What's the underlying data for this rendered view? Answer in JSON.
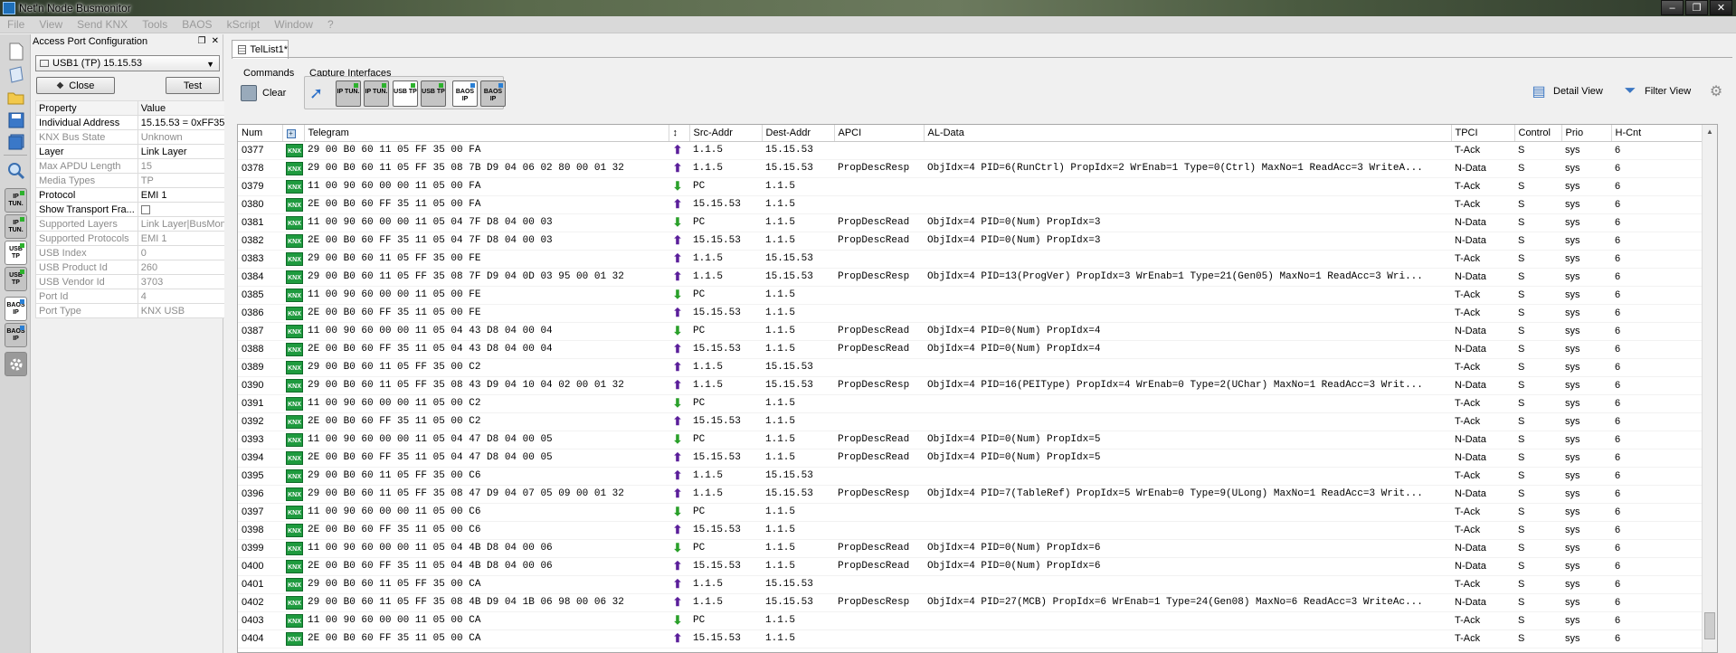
{
  "window": {
    "title": "Net'n Node Busmonitor",
    "minimize": "–",
    "maximize": "❐",
    "close": "✕"
  },
  "menu": [
    "File",
    "View",
    "Send KNX",
    "Tools",
    "BAOS",
    "kScript",
    "Window",
    "?"
  ],
  "left_toolbar": {
    "ip_tun_1": "IP TUN.",
    "ip_tun_2": "IP TUN.",
    "usb_tp_1": "USB TP",
    "usb_tp_2": "USB TP",
    "baos_ip_1": "BAOS IP",
    "baos_ip_2": "BAOS IP"
  },
  "access_port": {
    "header": "Access Port Configuration",
    "selected_port": "USB1 (TP) 15.15.53",
    "close_label": "Close",
    "test_label": "Test",
    "columns": [
      "Property",
      "Value"
    ],
    "properties": [
      {
        "name": "Individual Address",
        "value": "15.15.53 = 0xFF35",
        "enabled": true
      },
      {
        "name": "KNX Bus State",
        "value": "Unknown",
        "enabled": false
      },
      {
        "name": "Layer",
        "value": "Link Layer",
        "enabled": true
      },
      {
        "name": "Max APDU Length",
        "value": "15",
        "enabled": false
      },
      {
        "name": "Media Types",
        "value": "TP",
        "enabled": false
      },
      {
        "name": "Protocol",
        "value": "EMI 1",
        "enabled": true
      },
      {
        "name": "Show Transport Fra...",
        "value": "",
        "enabled": true,
        "checkbox": true
      },
      {
        "name": "Supported Layers",
        "value": "Link Layer|BusMon",
        "enabled": false
      },
      {
        "name": "Supported Protocols",
        "value": "EMI 1",
        "enabled": false
      },
      {
        "name": "USB Index",
        "value": "0",
        "enabled": false
      },
      {
        "name": "USB Product Id",
        "value": "260",
        "enabled": false
      },
      {
        "name": "USB Vendor Id",
        "value": "3703",
        "enabled": false
      },
      {
        "name": "Port Id",
        "value": "4",
        "enabled": false
      },
      {
        "name": "Port Type",
        "value": "KNX USB",
        "enabled": false
      }
    ]
  },
  "tab": {
    "label": "TelList1*"
  },
  "toolbar": {
    "commands_label": "Commands",
    "clear_label": "Clear",
    "capture_label": "Capture Interfaces",
    "cap_ip_tun_1": "IP TUN.",
    "cap_ip_tun_2": "IP TUN.",
    "cap_usb_tp_1": "USB TP",
    "cap_usb_tp_2": "USB TP",
    "cap_baos_ip_1": "BAOS IP",
    "cap_baos_ip_2": "BAOS IP",
    "detail_view": "Detail View",
    "filter_view": "Filter View"
  },
  "grid": {
    "columns": [
      "Num",
      "",
      "Telegram",
      "↕",
      "Src-Addr",
      "Dest-Addr",
      "APCI",
      "AL-Data",
      "TPCI",
      "Control",
      "Prio",
      "H-Cnt"
    ],
    "knx_badge": "KNX",
    "rows": [
      {
        "num": "0377",
        "tel": "29 00 B0 60 11 05 FF 35 00 FA",
        "dir": "up",
        "src": "1.1.5",
        "dst": "15.15.53",
        "apci": "",
        "al": "",
        "tpci": "T-Ack",
        "ctl": "S",
        "prio": "sys",
        "hc": "6"
      },
      {
        "num": "0378",
        "tel": "29 00 B0 60 11 05 FF 35 08 7B D9 04 06 02 80 00 01 32",
        "dir": "up",
        "src": "1.1.5",
        "dst": "15.15.53",
        "apci": "PropDescResp",
        "al": "ObjIdx=4 PID=6(RunCtrl) PropIdx=2 WrEnab=1 Type=0(Ctrl) MaxNo=1 ReadAcc=3 WriteA...",
        "tpci": "N-Data",
        "ctl": "S",
        "prio": "sys",
        "hc": "6"
      },
      {
        "num": "0379",
        "tel": "11 00 90 60 00 00 11 05 00 FA",
        "dir": "down",
        "src": "PC",
        "dst": "1.1.5",
        "apci": "",
        "al": "",
        "tpci": "T-Ack",
        "ctl": "S",
        "prio": "sys",
        "hc": "6"
      },
      {
        "num": "0380",
        "tel": "2E 00 B0 60 FF 35 11 05 00 FA",
        "dir": "up",
        "src": "15.15.53",
        "dst": "1.1.5",
        "apci": "",
        "al": "",
        "tpci": "T-Ack",
        "ctl": "S",
        "prio": "sys",
        "hc": "6"
      },
      {
        "num": "0381",
        "tel": "11 00 90 60 00 00 11 05 04 7F D8 04 00 03",
        "dir": "down",
        "src": "PC",
        "dst": "1.1.5",
        "apci": "PropDescRead",
        "al": "ObjIdx=4 PID=0(Num) PropIdx=3",
        "tpci": "N-Data",
        "ctl": "S",
        "prio": "sys",
        "hc": "6"
      },
      {
        "num": "0382",
        "tel": "2E 00 B0 60 FF 35 11 05 04 7F D8 04 00 03",
        "dir": "up",
        "src": "15.15.53",
        "dst": "1.1.5",
        "apci": "PropDescRead",
        "al": "ObjIdx=4 PID=0(Num) PropIdx=3",
        "tpci": "N-Data",
        "ctl": "S",
        "prio": "sys",
        "hc": "6"
      },
      {
        "num": "0383",
        "tel": "29 00 B0 60 11 05 FF 35 00 FE",
        "dir": "up",
        "src": "1.1.5",
        "dst": "15.15.53",
        "apci": "",
        "al": "",
        "tpci": "T-Ack",
        "ctl": "S",
        "prio": "sys",
        "hc": "6"
      },
      {
        "num": "0384",
        "tel": "29 00 B0 60 11 05 FF 35 08 7F D9 04 0D 03 95 00 01 32",
        "dir": "up",
        "src": "1.1.5",
        "dst": "15.15.53",
        "apci": "PropDescResp",
        "al": "ObjIdx=4 PID=13(ProgVer) PropIdx=3 WrEnab=1 Type=21(Gen05) MaxNo=1 ReadAcc=3 Wri...",
        "tpci": "N-Data",
        "ctl": "S",
        "prio": "sys",
        "hc": "6"
      },
      {
        "num": "0385",
        "tel": "11 00 90 60 00 00 11 05 00 FE",
        "dir": "down",
        "src": "PC",
        "dst": "1.1.5",
        "apci": "",
        "al": "",
        "tpci": "T-Ack",
        "ctl": "S",
        "prio": "sys",
        "hc": "6"
      },
      {
        "num": "0386",
        "tel": "2E 00 B0 60 FF 35 11 05 00 FE",
        "dir": "up",
        "src": "15.15.53",
        "dst": "1.1.5",
        "apci": "",
        "al": "",
        "tpci": "T-Ack",
        "ctl": "S",
        "prio": "sys",
        "hc": "6"
      },
      {
        "num": "0387",
        "tel": "11 00 90 60 00 00 11 05 04 43 D8 04 00 04",
        "dir": "down",
        "src": "PC",
        "dst": "1.1.5",
        "apci": "PropDescRead",
        "al": "ObjIdx=4 PID=0(Num) PropIdx=4",
        "tpci": "N-Data",
        "ctl": "S",
        "prio": "sys",
        "hc": "6"
      },
      {
        "num": "0388",
        "tel": "2E 00 B0 60 FF 35 11 05 04 43 D8 04 00 04",
        "dir": "up",
        "src": "15.15.53",
        "dst": "1.1.5",
        "apci": "PropDescRead",
        "al": "ObjIdx=4 PID=0(Num) PropIdx=4",
        "tpci": "N-Data",
        "ctl": "S",
        "prio": "sys",
        "hc": "6"
      },
      {
        "num": "0389",
        "tel": "29 00 B0 60 11 05 FF 35 00 C2",
        "dir": "up",
        "src": "1.1.5",
        "dst": "15.15.53",
        "apci": "",
        "al": "",
        "tpci": "T-Ack",
        "ctl": "S",
        "prio": "sys",
        "hc": "6"
      },
      {
        "num": "0390",
        "tel": "29 00 B0 60 11 05 FF 35 08 43 D9 04 10 04 02 00 01 32",
        "dir": "up",
        "src": "1.1.5",
        "dst": "15.15.53",
        "apci": "PropDescResp",
        "al": "ObjIdx=4 PID=16(PEIType) PropIdx=4 WrEnab=0 Type=2(UChar) MaxNo=1 ReadAcc=3 Writ...",
        "tpci": "N-Data",
        "ctl": "S",
        "prio": "sys",
        "hc": "6"
      },
      {
        "num": "0391",
        "tel": "11 00 90 60 00 00 11 05 00 C2",
        "dir": "down",
        "src": "PC",
        "dst": "1.1.5",
        "apci": "",
        "al": "",
        "tpci": "T-Ack",
        "ctl": "S",
        "prio": "sys",
        "hc": "6"
      },
      {
        "num": "0392",
        "tel": "2E 00 B0 60 FF 35 11 05 00 C2",
        "dir": "up",
        "src": "15.15.53",
        "dst": "1.1.5",
        "apci": "",
        "al": "",
        "tpci": "T-Ack",
        "ctl": "S",
        "prio": "sys",
        "hc": "6"
      },
      {
        "num": "0393",
        "tel": "11 00 90 60 00 00 11 05 04 47 D8 04 00 05",
        "dir": "down",
        "src": "PC",
        "dst": "1.1.5",
        "apci": "PropDescRead",
        "al": "ObjIdx=4 PID=0(Num) PropIdx=5",
        "tpci": "N-Data",
        "ctl": "S",
        "prio": "sys",
        "hc": "6"
      },
      {
        "num": "0394",
        "tel": "2E 00 B0 60 FF 35 11 05 04 47 D8 04 00 05",
        "dir": "up",
        "src": "15.15.53",
        "dst": "1.1.5",
        "apci": "PropDescRead",
        "al": "ObjIdx=4 PID=0(Num) PropIdx=5",
        "tpci": "N-Data",
        "ctl": "S",
        "prio": "sys",
        "hc": "6"
      },
      {
        "num": "0395",
        "tel": "29 00 B0 60 11 05 FF 35 00 C6",
        "dir": "up",
        "src": "1.1.5",
        "dst": "15.15.53",
        "apci": "",
        "al": "",
        "tpci": "T-Ack",
        "ctl": "S",
        "prio": "sys",
        "hc": "6"
      },
      {
        "num": "0396",
        "tel": "29 00 B0 60 11 05 FF 35 08 47 D9 04 07 05 09 00 01 32",
        "dir": "up",
        "src": "1.1.5",
        "dst": "15.15.53",
        "apci": "PropDescResp",
        "al": "ObjIdx=4 PID=7(TableRef) PropIdx=5 WrEnab=0 Type=9(ULong) MaxNo=1 ReadAcc=3 Writ...",
        "tpci": "N-Data",
        "ctl": "S",
        "prio": "sys",
        "hc": "6"
      },
      {
        "num": "0397",
        "tel": "11 00 90 60 00 00 11 05 00 C6",
        "dir": "down",
        "src": "PC",
        "dst": "1.1.5",
        "apci": "",
        "al": "",
        "tpci": "T-Ack",
        "ctl": "S",
        "prio": "sys",
        "hc": "6"
      },
      {
        "num": "0398",
        "tel": "2E 00 B0 60 FF 35 11 05 00 C6",
        "dir": "up",
        "src": "15.15.53",
        "dst": "1.1.5",
        "apci": "",
        "al": "",
        "tpci": "T-Ack",
        "ctl": "S",
        "prio": "sys",
        "hc": "6"
      },
      {
        "num": "0399",
        "tel": "11 00 90 60 00 00 11 05 04 4B D8 04 00 06",
        "dir": "down",
        "src": "PC",
        "dst": "1.1.5",
        "apci": "PropDescRead",
        "al": "ObjIdx=4 PID=0(Num) PropIdx=6",
        "tpci": "N-Data",
        "ctl": "S",
        "prio": "sys",
        "hc": "6"
      },
      {
        "num": "0400",
        "tel": "2E 00 B0 60 FF 35 11 05 04 4B D8 04 00 06",
        "dir": "up",
        "src": "15.15.53",
        "dst": "1.1.5",
        "apci": "PropDescRead",
        "al": "ObjIdx=4 PID=0(Num) PropIdx=6",
        "tpci": "N-Data",
        "ctl": "S",
        "prio": "sys",
        "hc": "6"
      },
      {
        "num": "0401",
        "tel": "29 00 B0 60 11 05 FF 35 00 CA",
        "dir": "up",
        "src": "1.1.5",
        "dst": "15.15.53",
        "apci": "",
        "al": "",
        "tpci": "T-Ack",
        "ctl": "S",
        "prio": "sys",
        "hc": "6"
      },
      {
        "num": "0402",
        "tel": "29 00 B0 60 11 05 FF 35 08 4B D9 04 1B 06 98 00 06 32",
        "dir": "up",
        "src": "1.1.5",
        "dst": "15.15.53",
        "apci": "PropDescResp",
        "al": "ObjIdx=4 PID=27(MCB) PropIdx=6 WrEnab=1 Type=24(Gen08) MaxNo=6 ReadAcc=3 WriteAc...",
        "tpci": "N-Data",
        "ctl": "S",
        "prio": "sys",
        "hc": "6"
      },
      {
        "num": "0403",
        "tel": "11 00 90 60 00 00 11 05 00 CA",
        "dir": "down",
        "src": "PC",
        "dst": "1.1.5",
        "apci": "",
        "al": "",
        "tpci": "T-Ack",
        "ctl": "S",
        "prio": "sys",
        "hc": "6"
      },
      {
        "num": "0404",
        "tel": "2E 00 B0 60 FF 35 11 05 00 CA",
        "dir": "up",
        "src": "15.15.53",
        "dst": "1.1.5",
        "apci": "",
        "al": "",
        "tpci": "T-Ack",
        "ctl": "S",
        "prio": "sys",
        "hc": "6"
      }
    ]
  }
}
